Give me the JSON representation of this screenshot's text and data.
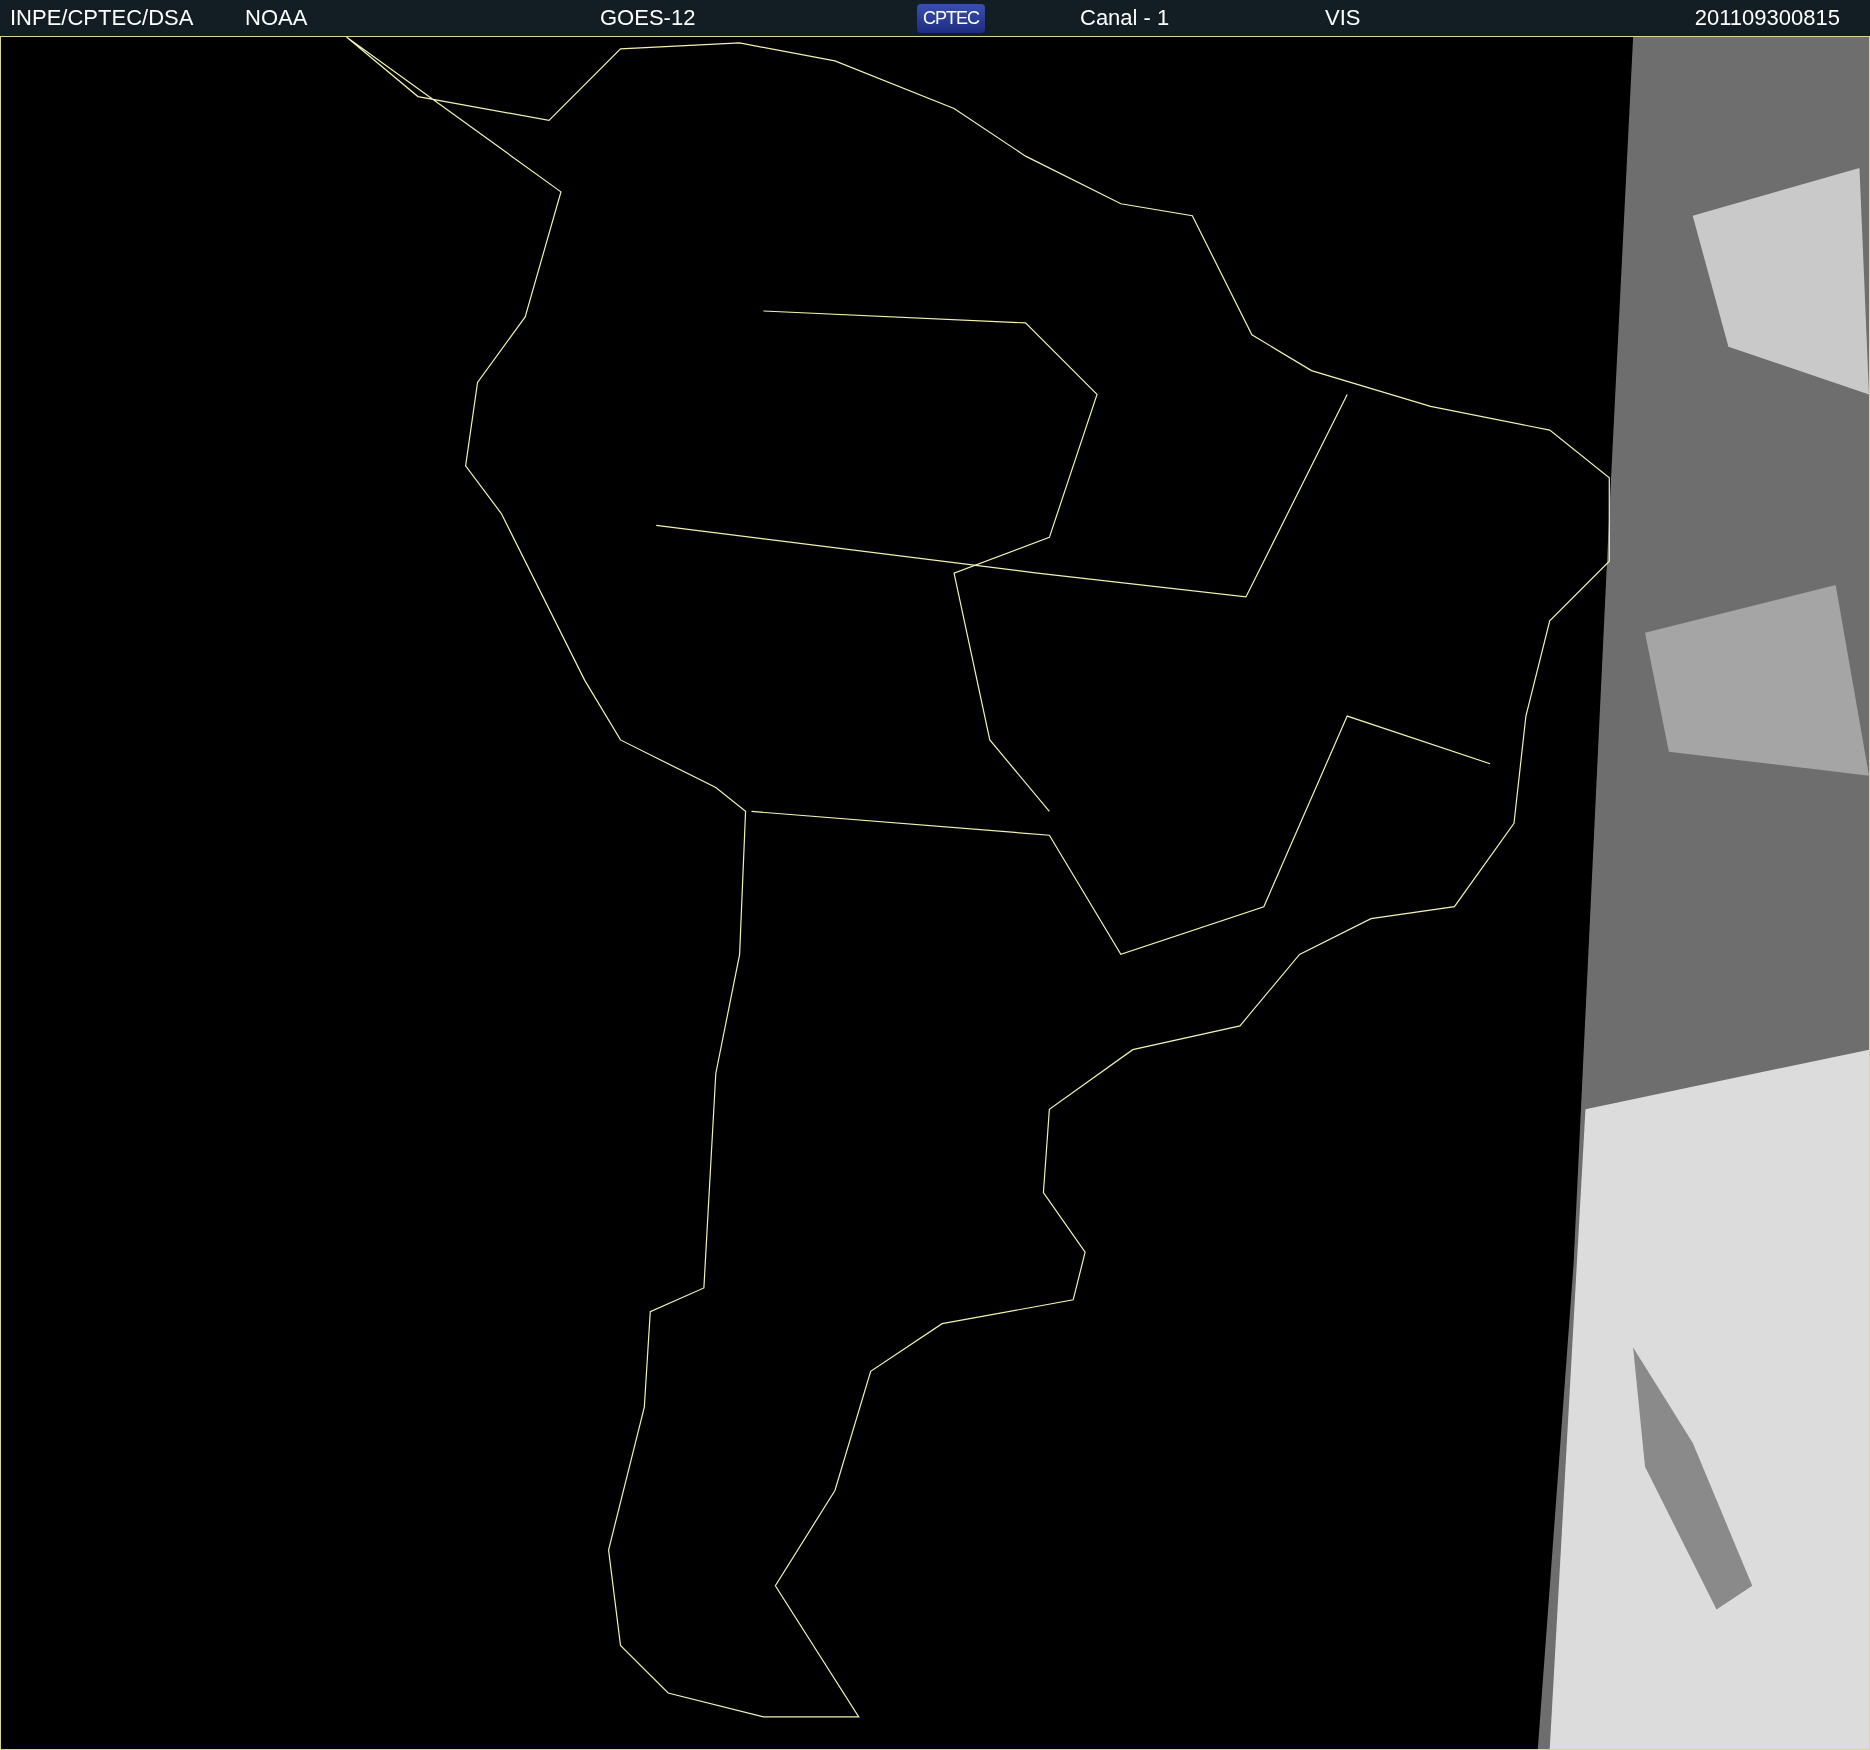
{
  "header": {
    "source": "INPE/CPTEC/DSA",
    "agency": "NOAA",
    "satellite": "GOES-12",
    "logo": {
      "text": "CPTEC"
    },
    "channel": "Canal - 1",
    "band": "VIS",
    "timestamp": "201109300815"
  }
}
